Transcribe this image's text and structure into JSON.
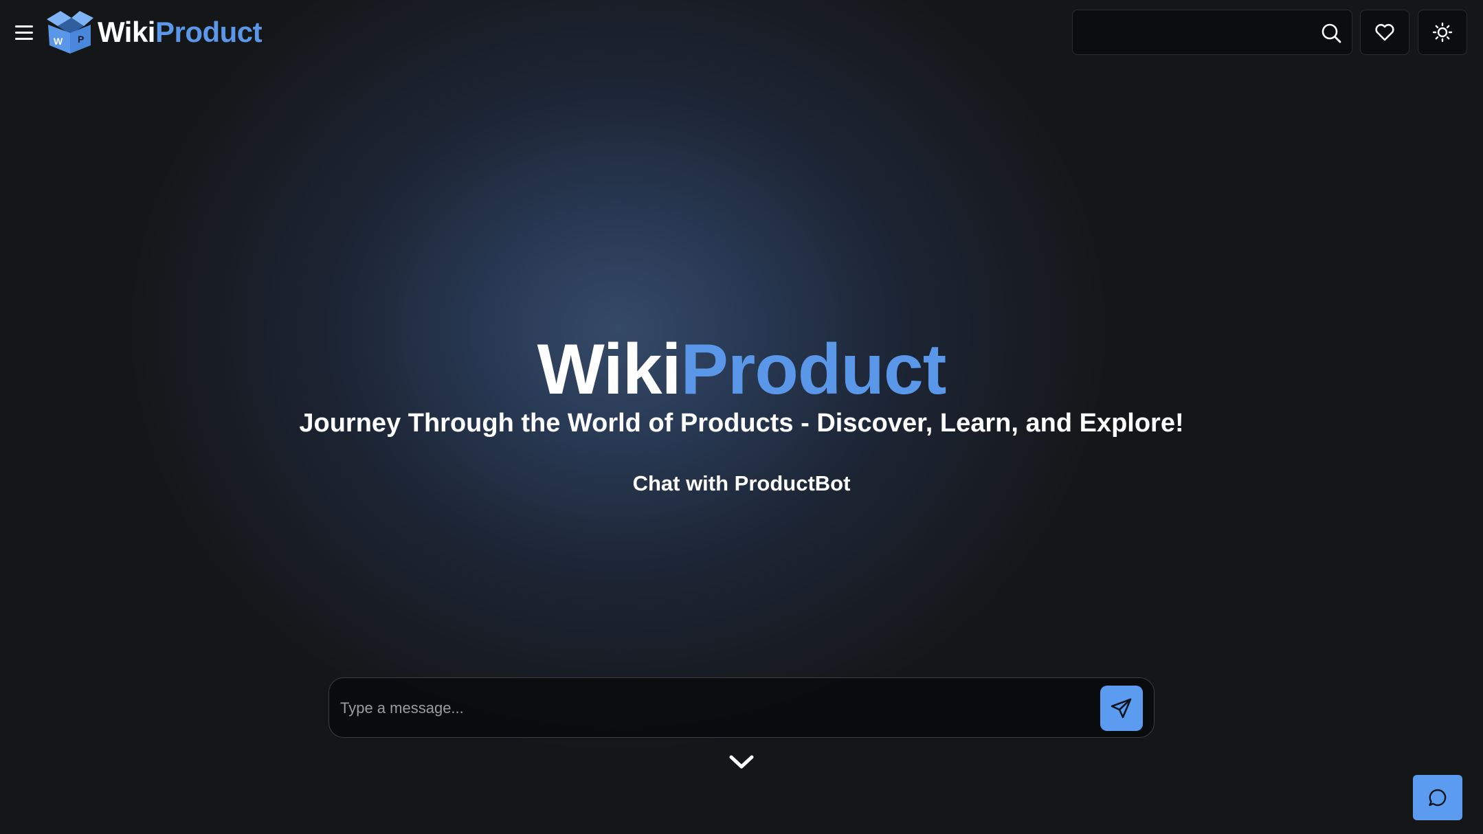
{
  "header": {
    "brand": {
      "part1": "Wiki",
      "part2": "Product"
    },
    "logo_letters": {
      "left": "W",
      "right": "P"
    },
    "search": {
      "placeholder": "",
      "value": ""
    }
  },
  "hero": {
    "title": {
      "part1": "Wiki",
      "part2": "Product"
    },
    "subtitle": "Journey Through the World of Products - Discover, Learn, and Explore!",
    "chat_heading": "Chat with ProductBot"
  },
  "chat": {
    "placeholder": "Type a message...",
    "value": ""
  },
  "icons": {
    "menu": "menu-icon",
    "search": "search-icon",
    "favorites": "heart-icon",
    "theme": "sun-icon",
    "send": "send-icon",
    "scroll": "chevron-down-icon",
    "chat_fab": "chat-bubble-icon"
  },
  "colors": {
    "accent": "#5b97e8",
    "button": "#5b9cf0",
    "background": "#151618",
    "glow": "#354a68"
  }
}
